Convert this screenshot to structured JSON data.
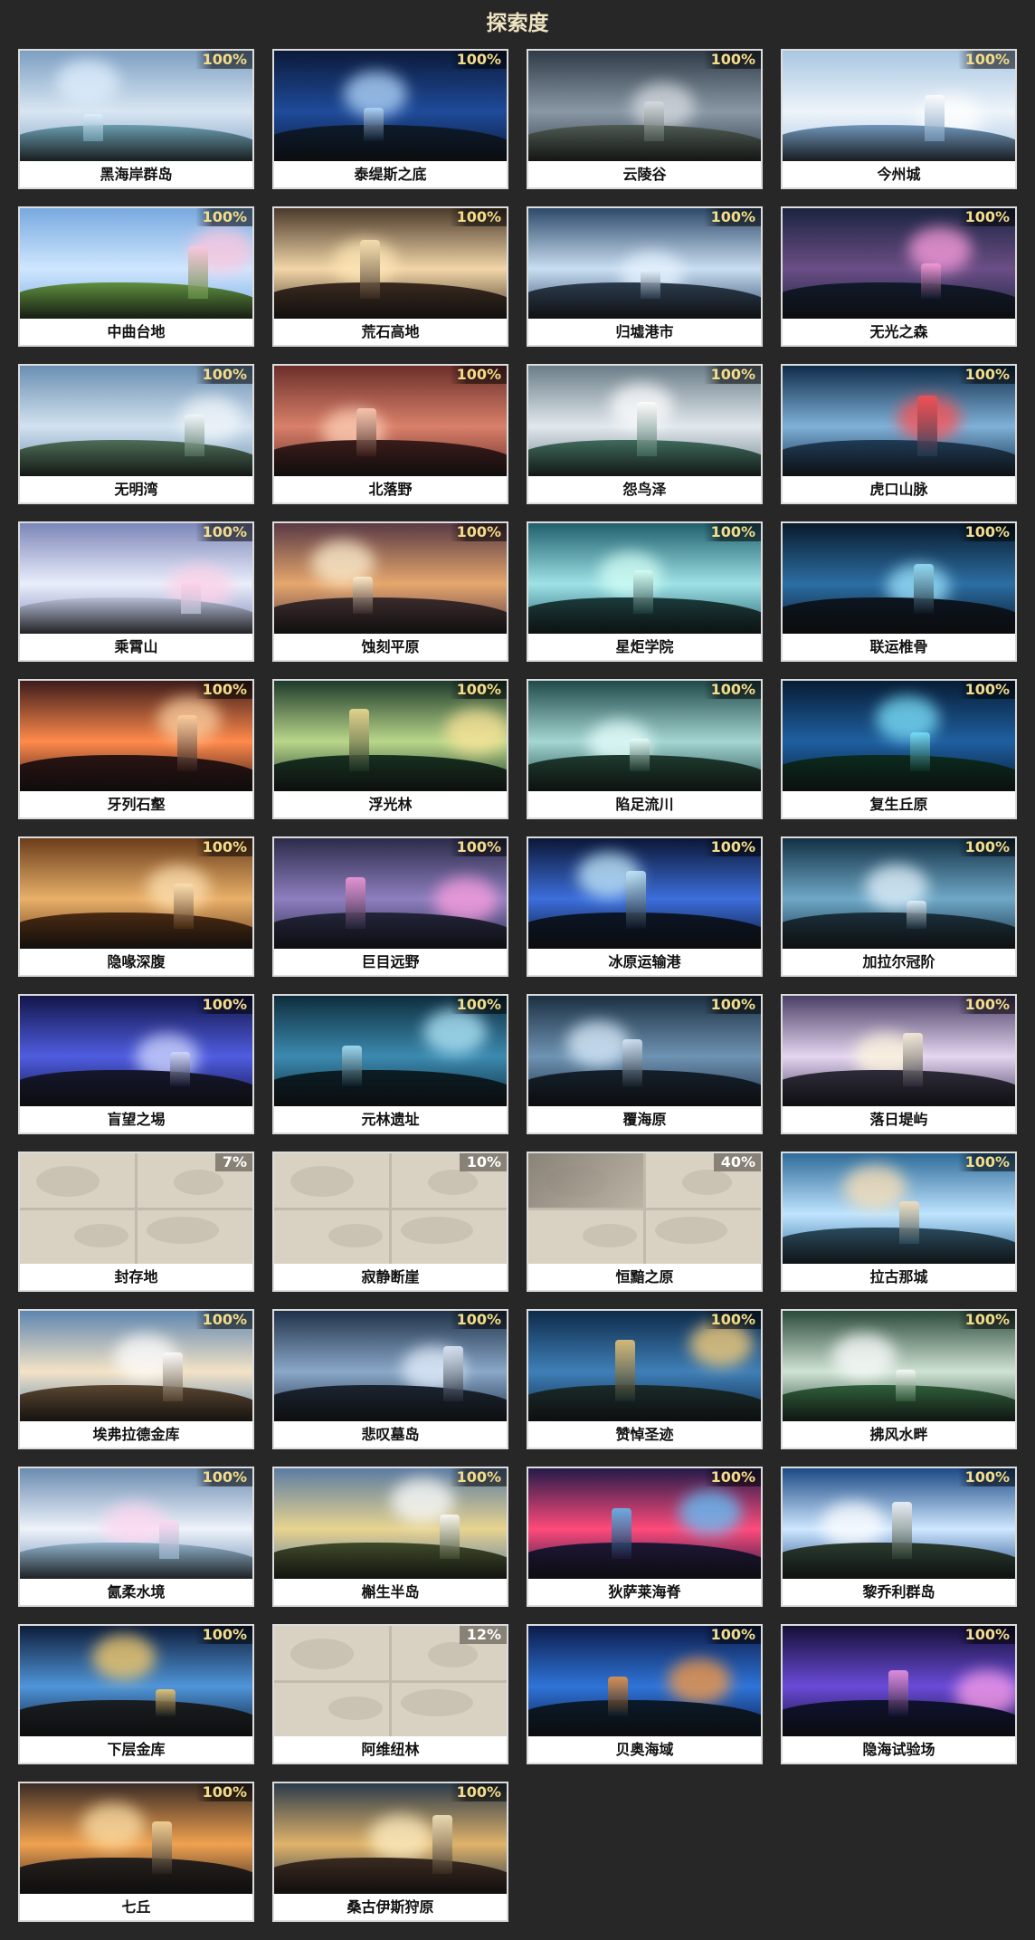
{
  "page": {
    "title": "探索度"
  },
  "regions": [
    {
      "name": "黑海岸群岛",
      "percent": "100%",
      "palette": [
        "#7d9fc2",
        "#d8e6f2",
        "#6a9cae",
        "#e1f0ff"
      ]
    },
    {
      "name": "泰缇斯之底",
      "percent": "100%",
      "palette": [
        "#0b1a3a",
        "#1f4b9a",
        "#0c1b2d",
        "#b8dcff"
      ]
    },
    {
      "name": "云陵谷",
      "percent": "100%",
      "palette": [
        "#2f3b47",
        "#8a98a6",
        "#4e5a52",
        "#d8dde2"
      ]
    },
    {
      "name": "今州城",
      "percent": "100%",
      "palette": [
        "#a8c6e2",
        "#eef4fa",
        "#6f94b8",
        "#ffffff"
      ]
    },
    {
      "name": "中曲台地",
      "percent": "100%",
      "palette": [
        "#78a9e0",
        "#cfe7ff",
        "#5e8f3f",
        "#ffc6dd"
      ]
    },
    {
      "name": "荒石高地",
      "percent": "100%",
      "palette": [
        "#4b3a2b",
        "#f2d6a8",
        "#3a2a1f",
        "#ffe7b6"
      ]
    },
    {
      "name": "归墟港市",
      "percent": "100%",
      "palette": [
        "#2e4a6a",
        "#c9def2",
        "#2b3b4d",
        "#e6f3ff"
      ]
    },
    {
      "name": "无光之森",
      "percent": "100%",
      "palette": [
        "#1b2440",
        "#6b4e86",
        "#111a2c",
        "#ff9fe0"
      ]
    },
    {
      "name": "无明湾",
      "percent": "100%",
      "palette": [
        "#6a8fb2",
        "#d2e2ef",
        "#4d6e57",
        "#f2f7fb"
      ]
    },
    {
      "name": "北落野",
      "percent": "100%",
      "palette": [
        "#6b2f2a",
        "#d9806a",
        "#3a1c1a",
        "#ffd1b8"
      ]
    },
    {
      "name": "怨鸟泽",
      "percent": "100%",
      "palette": [
        "#6b7d88",
        "#e2e9ee",
        "#3f6a5c",
        "#ffffff"
      ]
    },
    {
      "name": "虎口山脉",
      "percent": "100%",
      "palette": [
        "#0f2c4a",
        "#7fb1d8",
        "#1f3b55",
        "#ff4e4e"
      ]
    },
    {
      "name": "乘霄山",
      "percent": "100%",
      "palette": [
        "#7c86b8",
        "#eaeefb",
        "#b7bed6",
        "#ffd0e6"
      ]
    },
    {
      "name": "蚀刻平原",
      "percent": "100%",
      "palette": [
        "#5a3a45",
        "#e6a76d",
        "#3b2b2b",
        "#fff1d2"
      ]
    },
    {
      "name": "星炬学院",
      "percent": "100%",
      "palette": [
        "#1f5f6d",
        "#9fe2e6",
        "#1b3b3b",
        "#d6fff6"
      ]
    },
    {
      "name": "联运椎骨",
      "percent": "100%",
      "palette": [
        "#091a2c",
        "#2c6ea3",
        "#0c1520",
        "#9fe7ff"
      ]
    },
    {
      "name": "牙列石壑",
      "percent": "100%",
      "palette": [
        "#3d1c1a",
        "#ff8a4b",
        "#2a1412",
        "#ffd2a3"
      ]
    },
    {
      "name": "浮光林",
      "percent": "100%",
      "palette": [
        "#1e3a2b",
        "#b9d78a",
        "#173021",
        "#ffe59a"
      ]
    },
    {
      "name": "陷足流川",
      "percent": "100%",
      "palette": [
        "#204a4a",
        "#a4d6d2",
        "#1e3b2f",
        "#e8fffd"
      ]
    },
    {
      "name": "复生丘原",
      "percent": "100%",
      "palette": [
        "#071d35",
        "#1f5fa0",
        "#0b2b1f",
        "#7ee6ff"
      ]
    },
    {
      "name": "隐喙深腹",
      "percent": "100%",
      "palette": [
        "#6b3d1a",
        "#e9b06a",
        "#4a2a12",
        "#ffe2b3"
      ]
    },
    {
      "name": "巨目远野",
      "percent": "100%",
      "palette": [
        "#2b2b4a",
        "#8e7fbf",
        "#22243a",
        "#ff9fe0"
      ]
    },
    {
      "name": "冰原运输港",
      "percent": "100%",
      "palette": [
        "#0b1735",
        "#3c6edb",
        "#0b1526",
        "#c9f0ff"
      ]
    },
    {
      "name": "加拉尔冠阶",
      "percent": "100%",
      "palette": [
        "#123044",
        "#6fa8c7",
        "#1b2f3b",
        "#e8f6ff"
      ]
    },
    {
      "name": "盲望之埸",
      "percent": "100%",
      "palette": [
        "#13164a",
        "#4f5de0",
        "#15172e",
        "#d6dcff"
      ]
    },
    {
      "name": "元林遗址",
      "percent": "100%",
      "palette": [
        "#0e2d3d",
        "#3c8ab0",
        "#0b1e26",
        "#b6ecff"
      ]
    },
    {
      "name": "覆海原",
      "percent": "100%",
      "palette": [
        "#1b3042",
        "#6f93b3",
        "#14202c",
        "#dff0ff"
      ]
    },
    {
      "name": "落日堤屿",
      "percent": "100%",
      "palette": [
        "#4b3f66",
        "#e4d6f0",
        "#2e2b3a",
        "#fff7dc"
      ]
    },
    {
      "name": "封存地",
      "percent": "7%",
      "locked": true
    },
    {
      "name": "寂静断崖",
      "percent": "10%",
      "locked": true
    },
    {
      "name": "恒黯之原",
      "percent": "40%",
      "locked": true,
      "partial_shade": true
    },
    {
      "name": "拉古那城",
      "percent": "100%",
      "palette": [
        "#2f6c9a",
        "#bfe4ff",
        "#2a4b5e",
        "#ffe2b5"
      ]
    },
    {
      "name": "埃弗拉德金库",
      "percent": "100%",
      "palette": [
        "#5e86b0",
        "#f4e3c6",
        "#5a4630",
        "#ffffff"
      ]
    },
    {
      "name": "悲叹墓岛",
      "percent": "100%",
      "palette": [
        "#20324a",
        "#8aa8c8",
        "#1b2430",
        "#e8f2ff"
      ]
    },
    {
      "name": "赞悼圣迹",
      "percent": "100%",
      "palette": [
        "#0e2b4a",
        "#3f7fb7",
        "#1a2a2a",
        "#ffd27a"
      ]
    },
    {
      "name": "拂风水畔",
      "percent": "100%",
      "palette": [
        "#2b4a3a",
        "#cfe3d4",
        "#2f5e3a",
        "#ffffff"
      ]
    },
    {
      "name": "氤柔水境",
      "percent": "100%",
      "palette": [
        "#6a8bb0",
        "#eef3fb",
        "#8fb1c9",
        "#ffd6f0"
      ]
    },
    {
      "name": "槲生半岛",
      "percent": "100%",
      "palette": [
        "#5b7ca3",
        "#e8d48f",
        "#3f4a2a",
        "#ffffff"
      ]
    },
    {
      "name": "狄萨莱海脊",
      "percent": "100%",
      "palette": [
        "#241b4a",
        "#ff4a7a",
        "#1d1635",
        "#5cc6ff"
      ]
    },
    {
      "name": "黎乔利群岛",
      "percent": "100%",
      "palette": [
        "#1b4a86",
        "#cfe7ff",
        "#2a3b2f",
        "#ffffff"
      ]
    },
    {
      "name": "下层金库",
      "percent": "100%",
      "palette": [
        "#0e1d3a",
        "#4f95d9",
        "#1a1e22",
        "#ffd06a"
      ]
    },
    {
      "name": "阿维纽林",
      "percent": "12%",
      "locked": true
    },
    {
      "name": "贝奥海域",
      "percent": "100%",
      "palette": [
        "#0b1b4a",
        "#2f74d8",
        "#0b1a2a",
        "#ff9a3c"
      ]
    },
    {
      "name": "隐海试验场",
      "percent": "100%",
      "palette": [
        "#140f35",
        "#6a4bd8",
        "#0f1230",
        "#ff9fe8"
      ]
    },
    {
      "name": "七丘",
      "percent": "100%",
      "palette": [
        "#3a2b26",
        "#f0a24f",
        "#26201d",
        "#ffe1a8"
      ]
    },
    {
      "name": "桑古伊斯狩原",
      "percent": "100%",
      "palette": [
        "#2b3b4a",
        "#e0b36a",
        "#3a2a20",
        "#fff0c6"
      ]
    }
  ]
}
